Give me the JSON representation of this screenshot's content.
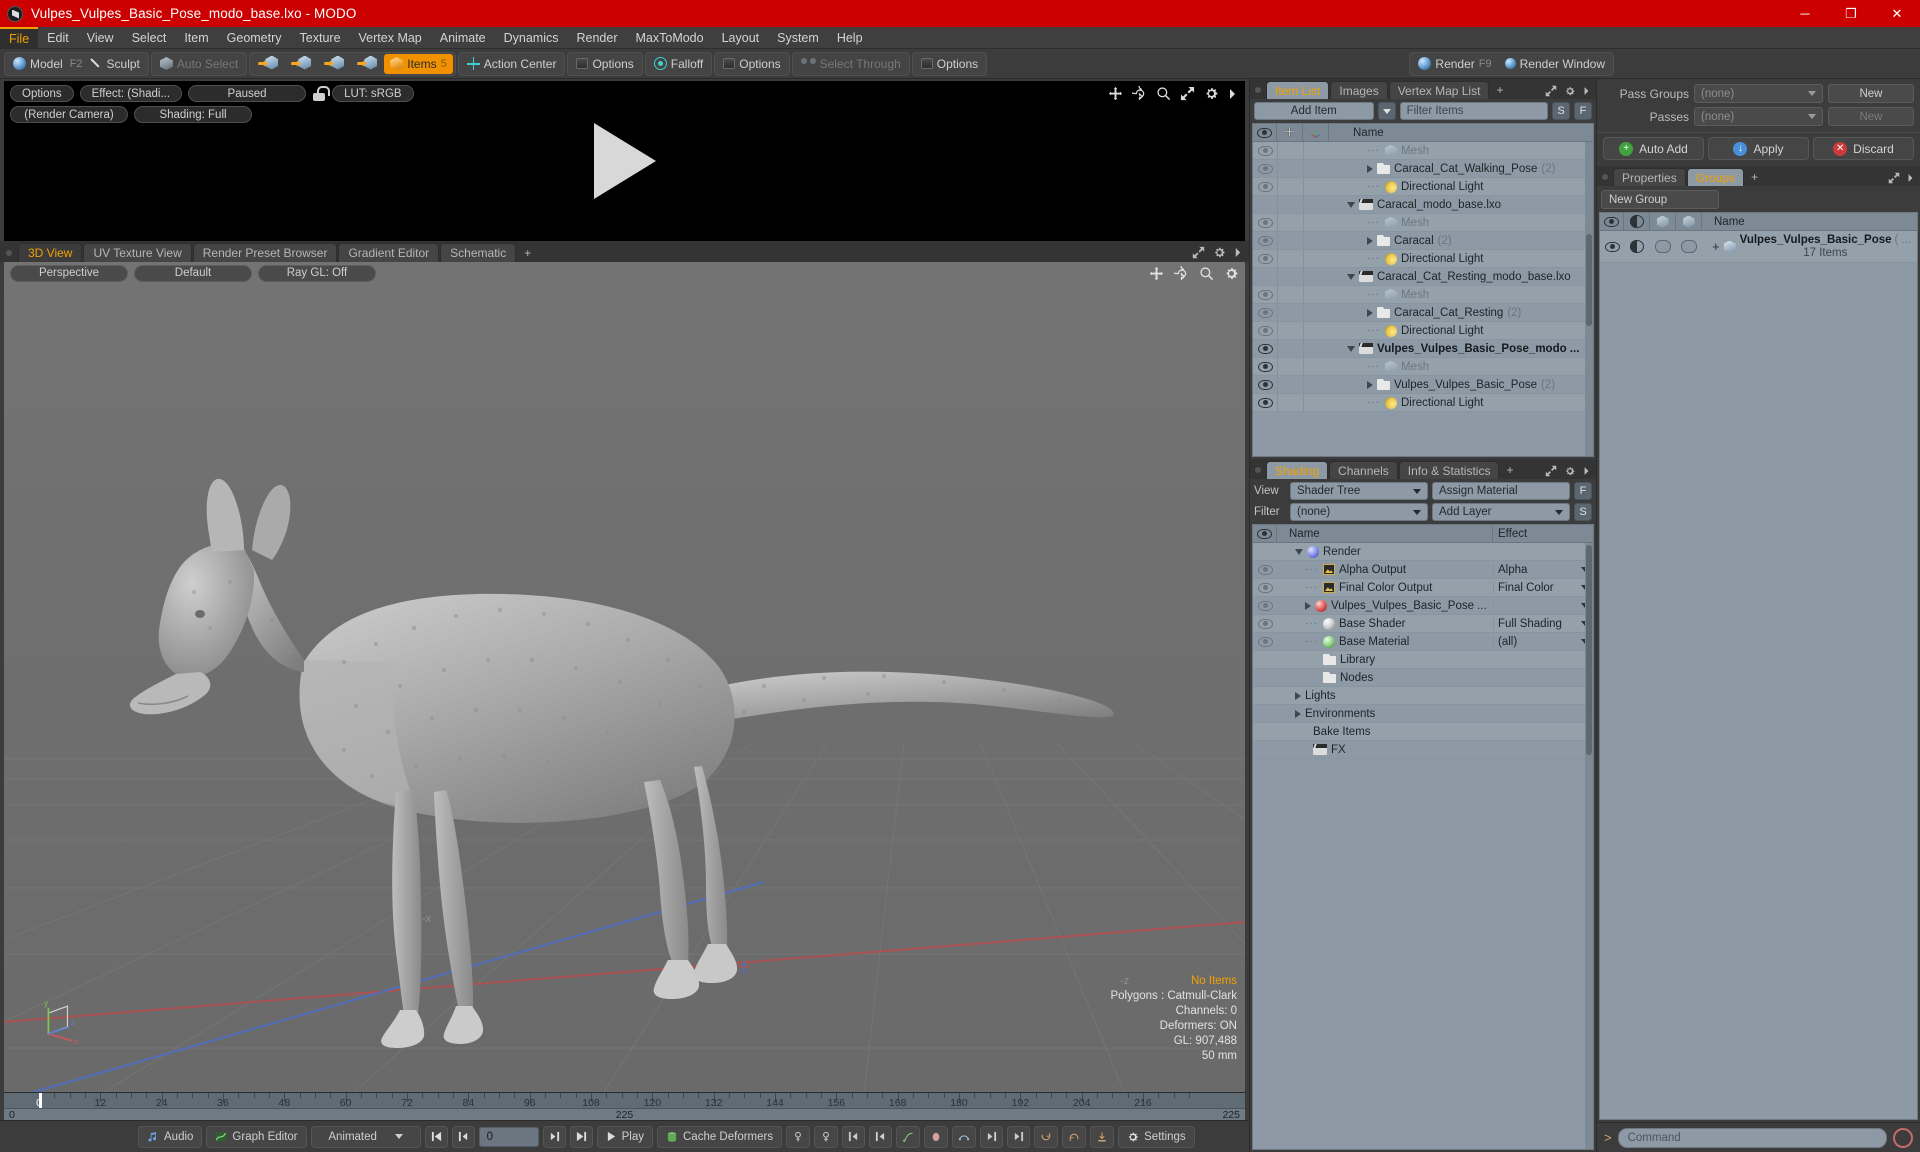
{
  "window": {
    "title": "Vulpes_Vulpes_Basic_Pose_modo_base.lxo - MODO",
    "minimize": "─",
    "maximize": "❐",
    "close": "✕"
  },
  "menubar": [
    {
      "label": "File",
      "active": true
    },
    {
      "label": "Edit"
    },
    {
      "label": "View"
    },
    {
      "label": "Select"
    },
    {
      "label": "Item"
    },
    {
      "label": "Geometry"
    },
    {
      "label": "Texture"
    },
    {
      "label": "Vertex Map"
    },
    {
      "label": "Animate"
    },
    {
      "label": "Dynamics"
    },
    {
      "label": "Render"
    },
    {
      "label": "MaxToModo"
    },
    {
      "label": "Layout"
    },
    {
      "label": "System"
    },
    {
      "label": "Help"
    }
  ],
  "toolbar": {
    "model": "Model",
    "model_key": "F2",
    "sculpt": "Sculpt",
    "auto_select": "Auto Select",
    "items": "Items",
    "items_key": "5",
    "action_center": "Action Center",
    "options1": "Options",
    "falloff": "Falloff",
    "options2": "Options",
    "select_through": "Select Through",
    "options3": "Options",
    "render": "Render",
    "render_key": "F9",
    "render_window": "Render Window"
  },
  "render_preview": {
    "options": "Options",
    "effect": "Effect: (Shadi...",
    "paused": "Paused",
    "lut": "LUT: sRGB",
    "camera": "(Render Camera)",
    "shading": "Shading: Full"
  },
  "viewport": {
    "tabs": [
      {
        "label": "3D View",
        "active": true
      },
      {
        "label": "UV Texture View"
      },
      {
        "label": "Render Preset Browser"
      },
      {
        "label": "Gradient Editor"
      },
      {
        "label": "Schematic"
      },
      {
        "label": "+"
      }
    ],
    "perspective": "Perspective",
    "shading_preset": "Default",
    "raygl": "Ray GL: Off",
    "axis_x": "-x",
    "axis_z": "-z",
    "info": {
      "selection": "No Items",
      "polygons": "Polygons : Catmull-Clark",
      "channels": "Channels: 0",
      "deformers": "Deformers: ON",
      "gl": "GL: 907,488",
      "grid": "50 mm"
    },
    "gizmo": {
      "y": "y",
      "x": "x",
      "z": "z"
    }
  },
  "timeline": {
    "ticks": [
      "0",
      "12",
      "24",
      "36",
      "48",
      "60",
      "72",
      "84",
      "96",
      "108",
      "120",
      "132",
      "144",
      "156",
      "168",
      "180",
      "192",
      "204",
      "216"
    ],
    "range_start": "0",
    "range_mid": "225",
    "range_end": "225"
  },
  "bottombar": {
    "audio": "Audio",
    "graph_editor": "Graph Editor",
    "mode": "Animated",
    "frame": "0",
    "play": "Play",
    "cache_deformers": "Cache Deformers",
    "settings": "Settings"
  },
  "item_list": {
    "tabs": [
      {
        "label": "Item List",
        "active": true
      },
      {
        "label": "Images"
      },
      {
        "label": "Vertex Map List"
      },
      {
        "label": "+"
      }
    ],
    "add_item": "Add Item",
    "filter_items": "Filter Items",
    "btn_s": "S",
    "btn_f": "F",
    "col_name": "Name",
    "rows": [
      {
        "indent": 3,
        "icon": "mesh",
        "label": "Mesh",
        "muted": true,
        "eye": "dim",
        "lead": "dot"
      },
      {
        "indent": 3,
        "icon": "folder",
        "label": "Caracal_Cat_Walking_Pose",
        "count": "(2)",
        "eye": "dim",
        "lead": "tri"
      },
      {
        "indent": 3,
        "icon": "light",
        "label": "Directional Light",
        "eye": "dim",
        "lead": "dot"
      },
      {
        "indent": 1,
        "icon": "clap",
        "label": "Caracal_modo_base.lxo",
        "eye": "none",
        "lead": "tridown"
      },
      {
        "indent": 3,
        "icon": "mesh",
        "label": "Mesh",
        "muted": true,
        "eye": "dim",
        "lead": "dot"
      },
      {
        "indent": 3,
        "icon": "folder",
        "label": "Caracal",
        "count": "(2)",
        "eye": "dim",
        "lead": "tri"
      },
      {
        "indent": 3,
        "icon": "light",
        "label": "Directional Light",
        "eye": "dim",
        "lead": "dot"
      },
      {
        "indent": 1,
        "icon": "clap",
        "label": "Caracal_Cat_Resting_modo_base.lxo",
        "eye": "none",
        "lead": "tridown"
      },
      {
        "indent": 3,
        "icon": "mesh",
        "label": "Mesh",
        "muted": true,
        "eye": "dim",
        "lead": "dot"
      },
      {
        "indent": 3,
        "icon": "folder",
        "label": "Caracal_Cat_Resting",
        "count": "(2)",
        "eye": "dim",
        "lead": "tri"
      },
      {
        "indent": 3,
        "icon": "light",
        "label": "Directional Light",
        "eye": "dim",
        "lead": "dot"
      },
      {
        "indent": 1,
        "icon": "clap",
        "label": "Vulpes_Vulpes_Basic_Pose_modo ...",
        "bold": true,
        "eye": "on",
        "lead": "tridown"
      },
      {
        "indent": 3,
        "icon": "mesh",
        "label": "Mesh",
        "muted": true,
        "eye": "on",
        "lead": "dot"
      },
      {
        "indent": 3,
        "icon": "folder",
        "label": "Vulpes_Vulpes_Basic_Pose",
        "count": "(2)",
        "eye": "on",
        "lead": "tri"
      },
      {
        "indent": 3,
        "icon": "light",
        "label": "Directional Light",
        "eye": "on",
        "lead": "dot"
      }
    ]
  },
  "shading": {
    "tabs": [
      {
        "label": "Shading",
        "active": true
      },
      {
        "label": "Channels"
      },
      {
        "label": "Info & Statistics"
      },
      {
        "label": "+"
      }
    ],
    "view_label": "View",
    "view_value": "Shader Tree",
    "assign_material": "Assign Material",
    "btn_f": "F",
    "filter_label": "Filter",
    "filter_value": "(none)",
    "add_layer": "Add Layer",
    "btn_s": "S",
    "col_name": "Name",
    "col_effect": "Effect",
    "rows": [
      {
        "indent": 1,
        "icon": "ballb",
        "label": "Render",
        "eye": "none",
        "lead": "tridown",
        "effect": ""
      },
      {
        "indent": 2,
        "icon": "img",
        "label": "Alpha Output",
        "eye": "dim",
        "lead": "dot",
        "effect": "Alpha"
      },
      {
        "indent": 2,
        "icon": "img",
        "label": "Final Color Output",
        "eye": "dim",
        "lead": "dot",
        "effect": "Final Color"
      },
      {
        "indent": 2,
        "icon": "ballr",
        "label": "Vulpes_Vulpes_Basic_Pose ...",
        "eye": "dim",
        "lead": "tri",
        "effect": ""
      },
      {
        "indent": 2,
        "icon": "ballw",
        "label": "Base Shader",
        "eye": "dim",
        "lead": "dot",
        "effect": "Full Shading"
      },
      {
        "indent": 2,
        "icon": "ballg",
        "label": "Base Material",
        "eye": "dim",
        "lead": "dot",
        "effect": "(all)"
      },
      {
        "indent": 2,
        "icon": "folder",
        "label": "Library",
        "eye": "none",
        "lead": "none",
        "effect": ""
      },
      {
        "indent": 2,
        "icon": "folder",
        "label": "Nodes",
        "eye": "none",
        "lead": "none",
        "effect": ""
      },
      {
        "indent": 1,
        "icon": "none",
        "label": "Lights",
        "eye": "none",
        "lead": "tri",
        "effect": ""
      },
      {
        "indent": 1,
        "icon": "none",
        "label": "Environments",
        "eye": "none",
        "lead": "tri",
        "effect": ""
      },
      {
        "indent": 1,
        "icon": "none",
        "label": "Bake Items",
        "eye": "none",
        "lead": "none",
        "effect": ""
      },
      {
        "indent": 1,
        "icon": "clap",
        "label": "FX",
        "eye": "none",
        "lead": "none",
        "effect": ""
      }
    ]
  },
  "passes": {
    "pass_groups_label": "Pass Groups",
    "pass_groups_value": "(none)",
    "pass_groups_new": "New",
    "passes_label": "Passes",
    "passes_value": "(none)",
    "passes_new": "New",
    "auto_add": "Auto Add",
    "apply": "Apply",
    "discard": "Discard"
  },
  "groups": {
    "tabs": [
      {
        "label": "Properties"
      },
      {
        "label": "Groups",
        "active": true
      },
      {
        "label": "+"
      }
    ],
    "new_group": "New Group",
    "col_name": "Name",
    "row": {
      "label": "Vulpes_Vulpes_Basic_Pose",
      "paren": "(",
      "ellipsis": "...",
      "items": "17 Items",
      "plus": "+"
    }
  },
  "command": {
    "prompt": ">",
    "placeholder": "Command"
  },
  "colors": {
    "title_red": "#cc0000",
    "accent_orange": "#f0a000",
    "panel_blue_gray": "#8d9aa5",
    "chrome": "#3c3c3c"
  }
}
